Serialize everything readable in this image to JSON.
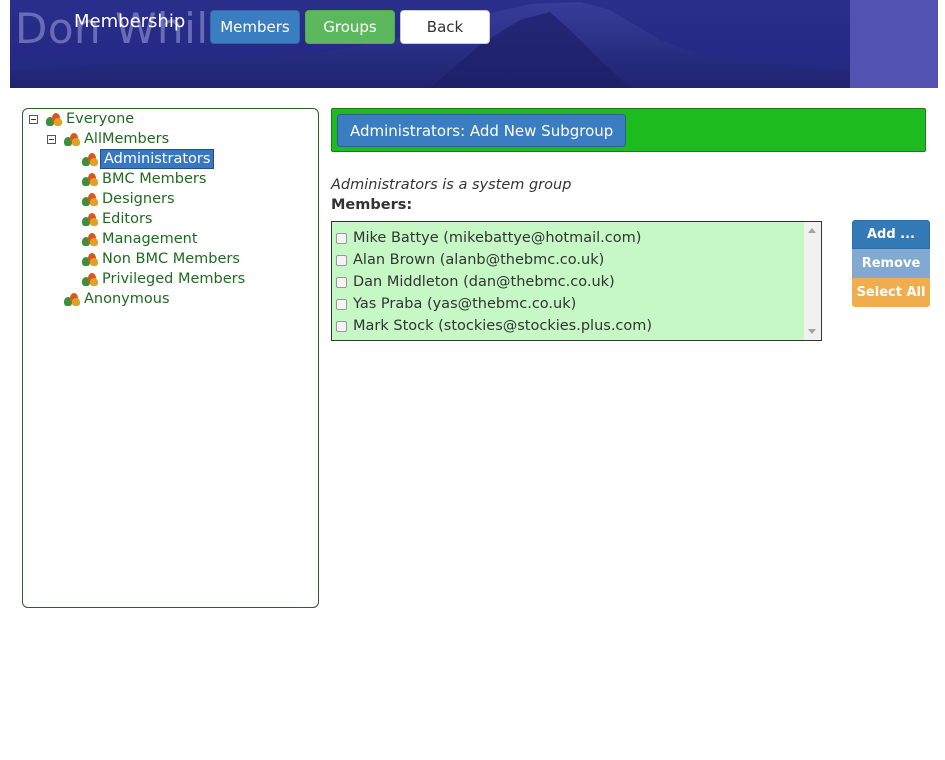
{
  "header": {
    "background_title": "Don Whilla",
    "section_title": "Membership",
    "nav": {
      "members": "Members",
      "groups": "Groups",
      "back": "Back"
    }
  },
  "tree": {
    "nodes": [
      {
        "label": "Everyone",
        "expanded": true,
        "selected": false
      },
      {
        "label": "AllMembers",
        "expanded": true,
        "selected": false
      },
      {
        "label": "Administrators",
        "selected": true
      },
      {
        "label": "BMC Members",
        "selected": false
      },
      {
        "label": "Designers",
        "selected": false
      },
      {
        "label": "Editors",
        "selected": false
      },
      {
        "label": "Management",
        "selected": false
      },
      {
        "label": "Non BMC Members",
        "selected": false
      },
      {
        "label": "Privileged Members",
        "selected": false
      },
      {
        "label": "Anonymous",
        "selected": false
      }
    ]
  },
  "main": {
    "add_subgroup_button": "Administrators: Add New Subgroup",
    "system_note": "Administrators is a system group",
    "members_label": "Members:",
    "members": [
      "Mike Battye (mikebattye@hotmail.com)",
      "Alan Brown (alanb@thebmc.co.uk)",
      "Dan Middleton (dan@thebmc.co.uk)",
      "Yas Praba (yas@thebmc.co.uk)",
      "Mark Stock (stockies@stockies.plus.com)"
    ],
    "actions": {
      "add": "Add ...",
      "remove": "Remove",
      "select_all": "Select All"
    }
  },
  "colors": {
    "header_blue": "#262a86",
    "green_bar": "#1ebb1e",
    "list_bg": "#c6f8c6",
    "button_blue": "#337ab7",
    "button_orange": "#f0ad4e",
    "tree_text": "#1f6b1f"
  }
}
